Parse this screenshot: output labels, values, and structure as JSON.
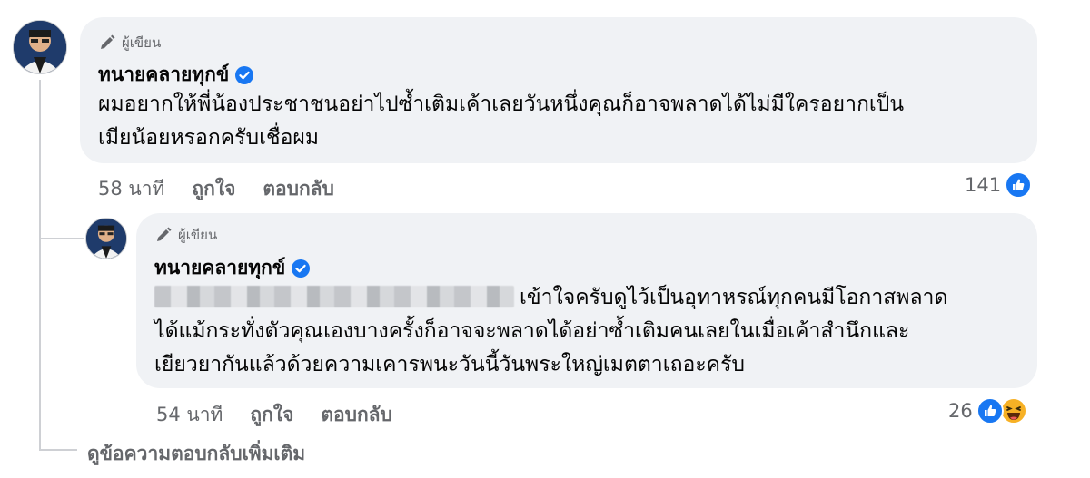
{
  "comment": {
    "author_badge": "ผู้เขียน",
    "author_name": "ทนายคลายทุกข์",
    "text_line1": "ผมอยากให้พี่น้องประชาชนอย่าไปซ้ำเติมเค้าเลยวันหนึ่งคุณก็อาจพลาดได้ไม่มีใครอยากเป็น",
    "text_line2": "เมียน้อยหรอกครับเชื่อผม",
    "time": "58 นาที",
    "like_label": "ถูกใจ",
    "reply_label": "ตอบกลับ",
    "reaction_count": "141",
    "reactions": [
      "like-icon"
    ]
  },
  "reply": {
    "author_badge": "ผู้เขียน",
    "author_name": "ทนายคลายทุกข์",
    "text_line1": "เข้าใจครับดูไว้เป็นอุทาหรณ์ทุกคนมีโอกาสพลาด",
    "text_line2": "ได้แม้กระทั่งตัวคุณเองบางครั้งก็อาจจะพลาดได้อย่าซ้ำเติมคนเลยในเมื่อเค้าสำนึกและ",
    "text_line3": "เยียวยากันแล้วด้วยความเคารพนะวันนี้วันพระใหญ่เมตตาเถอะครับ",
    "time": "54 นาที",
    "like_label": "ถูกใจ",
    "reply_label": "ตอบกลับ",
    "reaction_count": "26",
    "reactions": [
      "like-icon",
      "haha-icon"
    ]
  },
  "more_replies_label": "ดูข้อความตอบกลับเพิ่มเติม",
  "colors": {
    "bubble": "#f0f2f5",
    "like_blue": "#1877f2",
    "muted_text": "#65676b",
    "haha_yellow": "#f7b125"
  }
}
